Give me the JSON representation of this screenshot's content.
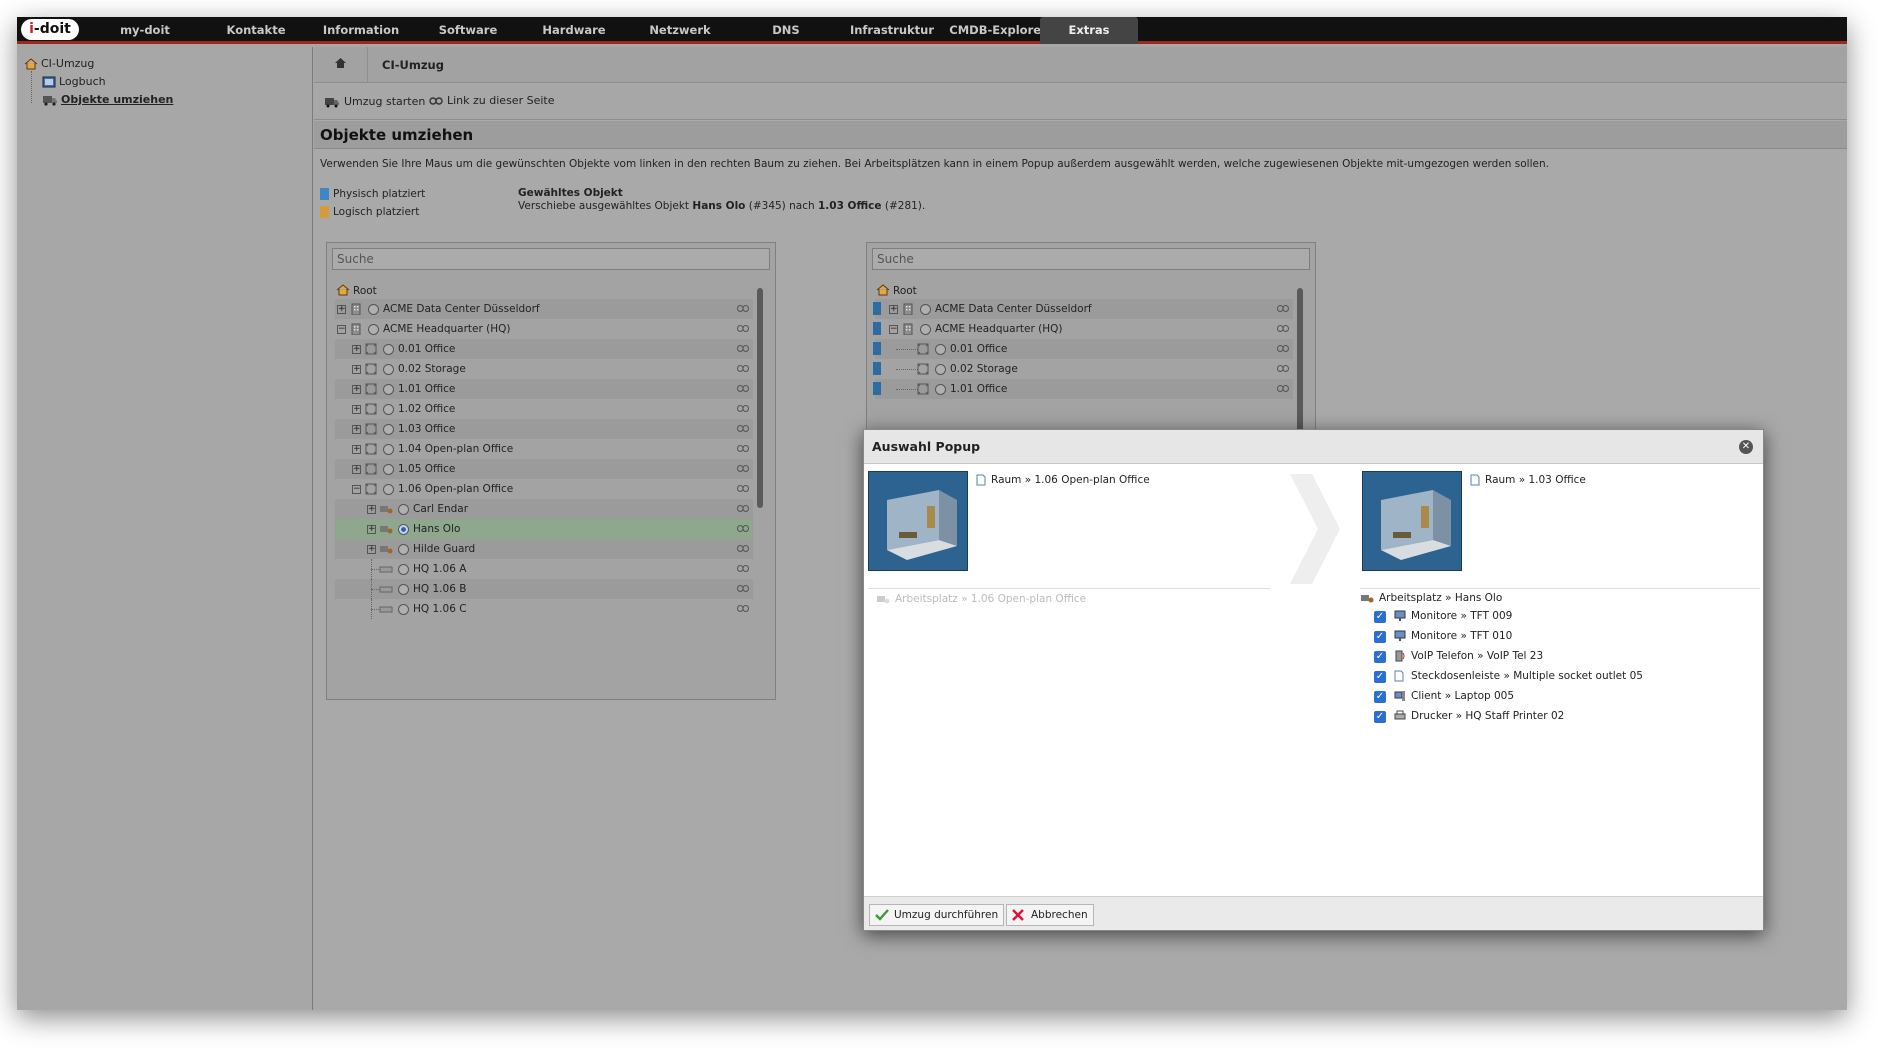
{
  "app": {
    "logo": "i-doit"
  },
  "nav": {
    "items": [
      "my-doit",
      "Kontakte",
      "Information",
      "Software",
      "Hardware",
      "Netzwerk",
      "DNS",
      "Infrastruktur",
      "CMDB-Explorer",
      "Extras"
    ],
    "active": "Extras"
  },
  "sidebar": {
    "root": "CI-Umzug",
    "items": [
      {
        "label": "Logbuch",
        "icon": "book-icon"
      },
      {
        "label": "Objekte umziehen",
        "icon": "truck-icon"
      }
    ]
  },
  "breadcrumb": {
    "current": "CI-Umzug"
  },
  "toolbar": {
    "start_label": "Umzug starten",
    "link_label": "Link zu dieser Seite"
  },
  "page": {
    "title": "Objekte umziehen",
    "description": "Verwenden Sie Ihre Maus um die gewünschten Objekte vom linken in den rechten Baum zu ziehen. Bei Arbeitsplätzen kann in einem Popup außerdem ausgewählt werden, welche zugewiesenen Objekte mit-umgezogen werden sollen.",
    "legend_physical": "Physisch platziert",
    "legend_logical": "Logisch platziert",
    "legend_physical_color": "#3f86c4",
    "legend_logical_color": "#d49a3c",
    "selected_heading": "Gewähltes Objekt",
    "selected_prefix": "Verschiebe ausgewähltes Objekt",
    "selected_object": "Hans Olo",
    "selected_object_id": "(#345) nach",
    "selected_target": "1.03 Office",
    "selected_target_id": "(#281)."
  },
  "left_tree": {
    "search_placeholder": "Suche",
    "root": "Root",
    "rows": [
      "ACME Data Center Düsseldorf",
      "ACME Headquarter (HQ)",
      "0.01 Office",
      "0.02 Storage",
      "1.01 Office",
      "1.02 Office",
      "1.03 Office",
      "1.04 Open-plan Office",
      "1.05 Office",
      "1.06 Open-plan Office",
      "Carl Endar",
      "Hans Olo",
      "Hilde Guard",
      "HQ 1.06 A",
      "HQ 1.06 B",
      "HQ 1.06 C"
    ]
  },
  "right_tree": {
    "search_placeholder": "Suche",
    "root": "Root",
    "rows": [
      "ACME Data Center Düsseldorf",
      "ACME Headquarter (HQ)",
      "0.01 Office",
      "0.02 Storage",
      "1.01 Office"
    ]
  },
  "popup": {
    "title": "Auswahl Popup",
    "source_room": "Raum » 1.06 Open-plan Office",
    "source_workplace": "Arbeitsplatz » 1.06 Open-plan Office",
    "target_room": "Raum » 1.03 Office",
    "target_workplace": "Arbeitsplatz » Hans Olo",
    "items": [
      {
        "label": "Monitore » TFT 009",
        "icon": "monitor-icon",
        "checked": true
      },
      {
        "label": "Monitore » TFT 010",
        "icon": "monitor-icon",
        "checked": true
      },
      {
        "label": "VoIP Telefon » VoIP Tel 23",
        "icon": "phone-icon",
        "checked": true
      },
      {
        "label": "Steckdosenleiste » Multiple socket outlet 05",
        "icon": "document-icon",
        "checked": true
      },
      {
        "label": "Client » Laptop 005",
        "icon": "computer-icon",
        "checked": true
      },
      {
        "label": "Drucker » HQ Staff Printer 02",
        "icon": "printer-icon",
        "checked": true
      }
    ],
    "confirm_label": "Umzug durchführen",
    "cancel_label": "Abbrechen"
  }
}
